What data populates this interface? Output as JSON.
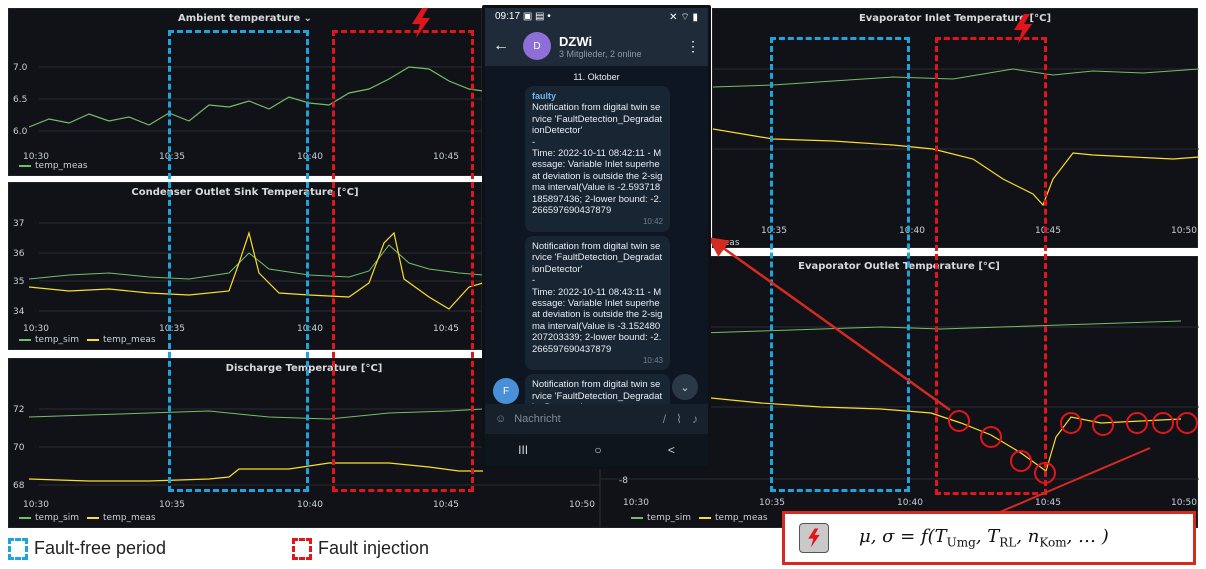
{
  "colors": {
    "dashboard_bg": "#111217",
    "series_green": "#73bf69",
    "series_yellow": "#fade2a",
    "fault_free": "#1fa3dc",
    "fault_injection": "#e0161b",
    "phone_bg": "#0e1621",
    "annotation_red": "#d42a20"
  },
  "left_panels": [
    {
      "title": "Ambient temperature ⌄",
      "y_ticks": [
        "7.0",
        "6.5",
        "6.0"
      ],
      "x_ticks": [
        "10:30",
        "10:35",
        "10:40",
        "10:45"
      ],
      "legend": [
        "temp_meas"
      ]
    },
    {
      "title": "Condenser Outlet Sink Temperature [°C]",
      "y_ticks": [
        "37",
        "36",
        "35",
        "34"
      ],
      "x_ticks": [
        "10:30",
        "10:35",
        "10:40",
        "10:45"
      ],
      "legend": [
        "temp_sim",
        "temp_meas"
      ]
    },
    {
      "title": "Discharge Temperature [°C]",
      "y_ticks": [
        "72",
        "70",
        "68"
      ],
      "x_ticks": [
        "10:30",
        "10:35",
        "10:40",
        "10:45",
        "10:50"
      ],
      "legend": [
        "temp_sim",
        "temp_meas"
      ]
    }
  ],
  "right_panels": [
    {
      "title": "Evaporator Inlet Temperature [°C]",
      "x_ticks": [
        "10:35",
        "10:40",
        "10:45",
        "10:50"
      ],
      "legend_fragment": "meas"
    },
    {
      "title": "Evaporator Outlet Temperature [°C]",
      "y_ticks": [
        "-8"
      ],
      "x_ticks": [
        "10:30",
        "10:35",
        "10:40",
        "10:45",
        "10:50"
      ],
      "legend": [
        "temp_sim",
        "temp_meas"
      ]
    }
  ],
  "phone": {
    "status_time": "09:17",
    "status_icons": "▣ ▤ •",
    "status_right": "✕ ⌔ ▮",
    "chat_avatar": "D",
    "chat_name": "DZWi",
    "chat_subtitle": "3 Mitglieder, 2 online",
    "date": "11. Oktober",
    "messages": [
      {
        "sender": "faulty",
        "text": "Notification from digital twin service 'FaultDetection_DegradationDetector'\n-\nTime: 2022-10-11 08:42:11 - Message: Variable Inlet superheat deviation is outside the 2-sigma interval(Value is -2.593718185897436; 2-lower bound: -2.266597690437879",
        "time": "10:42"
      },
      {
        "sender": "",
        "text": "Notification from digital twin service 'FaultDetection_DegradationDetector'\n-\nTime: 2022-10-11 08:43:11 - Message: Variable Inlet superheat deviation is outside the 2-sigma interval(Value is -3.152480207203339; 2-lower bound: -2.266597690437879",
        "time": "10:43"
      },
      {
        "sender": "",
        "text": "Notification from digital twin service 'FaultDetection_DegradationDetector'",
        "time": ""
      }
    ],
    "sender_avatar": "F",
    "input_placeholder": "Nachricht",
    "nav": [
      "III",
      "○",
      "<"
    ]
  },
  "bottom_legend": {
    "fault_free": "Fault-free period",
    "fault_injection": "Fault injection"
  },
  "formula": {
    "prefix": "μ, σ = f(T",
    "sub1": "Umg",
    "mid1": ", T",
    "sub2": "RL",
    "mid2": ", n",
    "sub3": "Kom",
    "suffix": ", … )"
  }
}
